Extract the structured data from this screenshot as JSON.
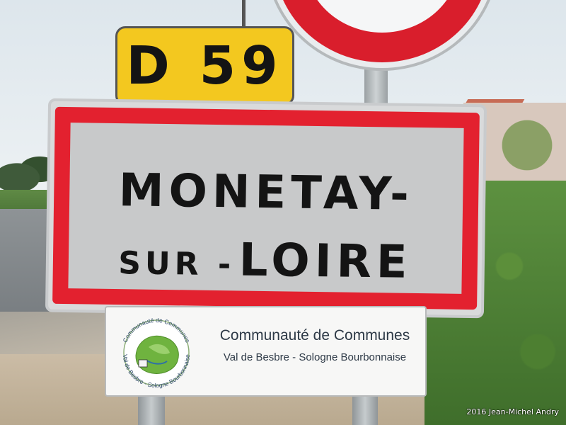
{
  "road_plate": {
    "text": "D 59",
    "color": "#f3c81f"
  },
  "town_sign": {
    "line1": "MONETAY-",
    "line2_prefix": "SUR -",
    "line2_main": "LOIRE",
    "border_color": "#e3212f"
  },
  "community_plate": {
    "title": "Communauté de Communes",
    "subtitle": "Val de Besbre - Sologne Bourbonnaise",
    "logo_top_text": "Communauté de Communes",
    "logo_bottom_text": "Val de Besbre - Sologne Bourbonnaise"
  },
  "prohibition_sign": {
    "color": "#d91e2c"
  },
  "credit": "2016 Jean-Michel Andry"
}
